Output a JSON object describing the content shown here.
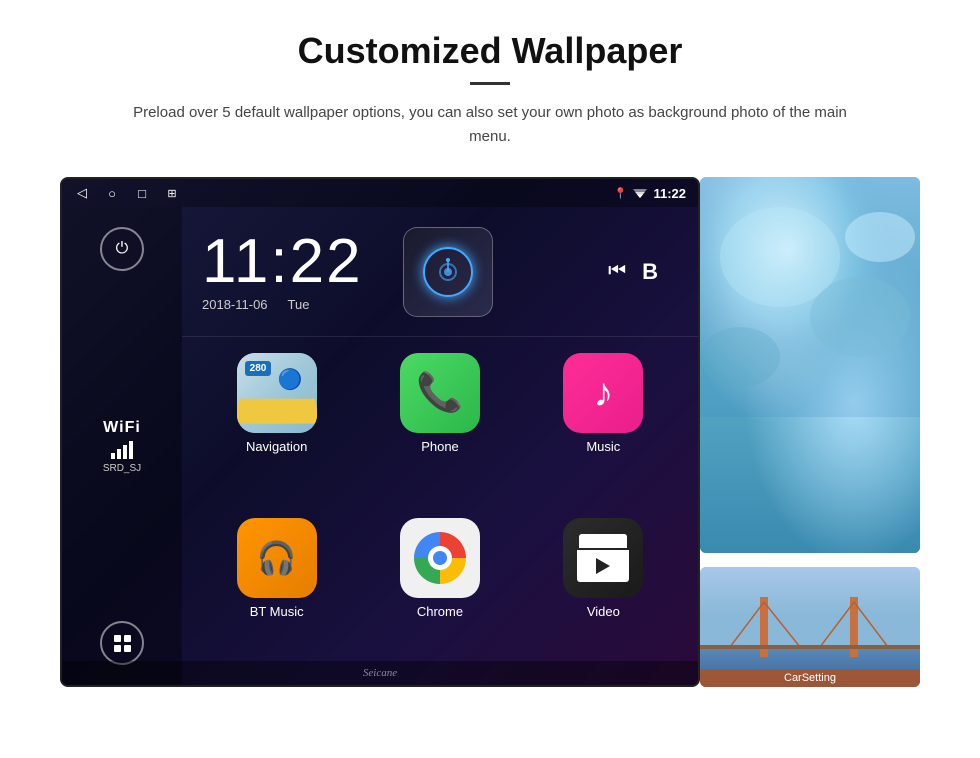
{
  "header": {
    "title": "Customized Wallpaper",
    "divider": true,
    "description": "Preload over 5 default wallpaper options, you can also set your own photo as background photo of the main menu."
  },
  "device": {
    "statusBar": {
      "time": "11:22",
      "navIcons": [
        "◁",
        "○",
        "□",
        "⊞"
      ],
      "rightIcons": [
        "location",
        "signal",
        "time"
      ]
    },
    "clock": {
      "time": "11:22",
      "date": "2018-11-06",
      "day": "Tue"
    },
    "wifi": {
      "label": "WiFi",
      "ssid": "SRD_SJ"
    },
    "apps": [
      {
        "name": "Navigation",
        "type": "nav",
        "badge": "280"
      },
      {
        "name": "Phone",
        "type": "phone"
      },
      {
        "name": "Music",
        "type": "music"
      },
      {
        "name": "BT Music",
        "type": "bt"
      },
      {
        "name": "Chrome",
        "type": "chrome"
      },
      {
        "name": "Video",
        "type": "video"
      }
    ],
    "carsetting": "CarSetting",
    "watermark": "Seicane"
  }
}
